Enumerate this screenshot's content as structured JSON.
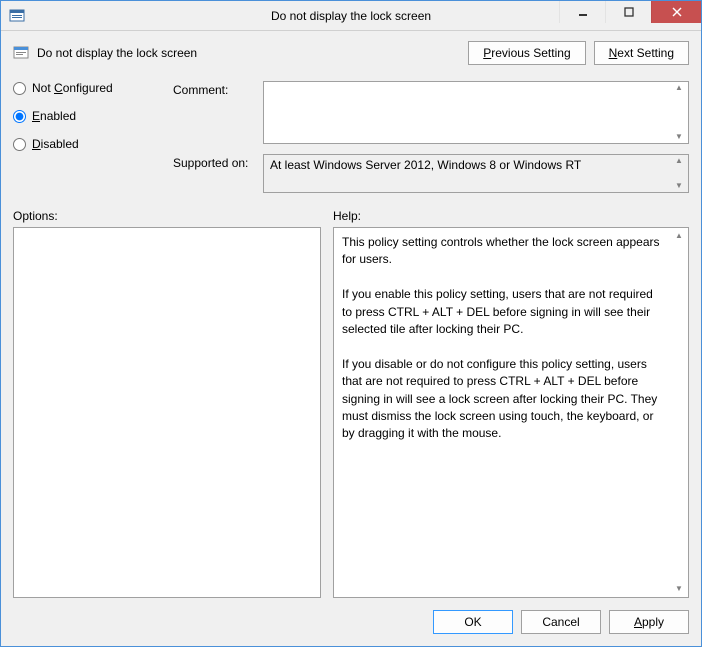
{
  "window": {
    "title": "Do not display the lock screen"
  },
  "header": {
    "policy_name": "Do not display the lock screen",
    "previous_button": "Previous Setting",
    "next_button": "Next Setting"
  },
  "config": {
    "not_configured_label": "Not Configured",
    "enabled_label": "Enabled",
    "disabled_label": "Disabled",
    "selected": "enabled",
    "comment_label": "Comment:",
    "comment_value": "",
    "supported_label": "Supported on:",
    "supported_value": "At least Windows Server 2012, Windows 8 or Windows RT"
  },
  "panels": {
    "options_label": "Options:",
    "help_label": "Help:",
    "help_p1": "This policy setting controls whether the lock screen appears for users.",
    "help_p2": "If you enable this policy setting, users that are not required to press CTRL + ALT + DEL before signing in will see their selected tile after  locking their PC.",
    "help_p3": "If you disable or do not configure this policy setting, users that are not required to press CTRL + ALT + DEL before signing in will see a lock screen after locking their PC. They must dismiss the lock screen using touch, the keyboard, or by dragging it with the mouse."
  },
  "footer": {
    "ok": "OK",
    "cancel": "Cancel",
    "apply": "Apply"
  }
}
